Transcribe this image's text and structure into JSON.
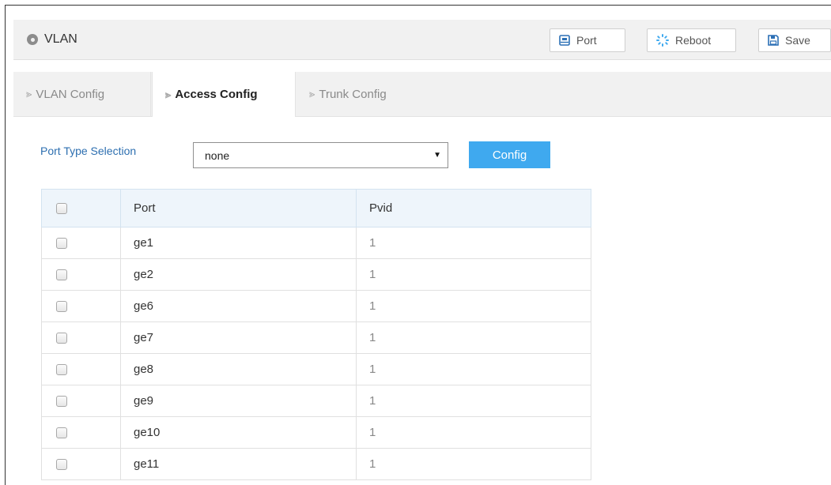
{
  "header": {
    "title": "VLAN",
    "port_label": "Port",
    "reboot_label": "Reboot",
    "save_label": "Save"
  },
  "tabs": [
    {
      "label": "VLAN Config",
      "active": false
    },
    {
      "label": "Access Config",
      "active": true
    },
    {
      "label": "Trunk Config",
      "active": false
    }
  ],
  "port_type": {
    "label": "Port Type Selection",
    "selected": "none",
    "config_label": "Config"
  },
  "table": {
    "columns": [
      "Port",
      "Pvid"
    ],
    "rows": [
      {
        "port": "ge1",
        "pvid": "1"
      },
      {
        "port": "ge2",
        "pvid": "1"
      },
      {
        "port": "ge6",
        "pvid": "1"
      },
      {
        "port": "ge7",
        "pvid": "1"
      },
      {
        "port": "ge8",
        "pvid": "1"
      },
      {
        "port": "ge9",
        "pvid": "1"
      },
      {
        "port": "ge10",
        "pvid": "1"
      },
      {
        "port": "ge11",
        "pvid": "1"
      }
    ]
  },
  "icons": {
    "title": "location-dot-icon",
    "port": "port-icon",
    "reboot": "reboot-spinner-icon",
    "save": "save-floppy-icon",
    "tab": "chevron-right-icon",
    "select": "dropdown-arrow-icon"
  },
  "colors": {
    "accent_button": "#3fa9ef",
    "label_blue": "#2d6fb0",
    "header_bg": "#f1f1f1",
    "table_header_bg": "#eef5fb"
  }
}
